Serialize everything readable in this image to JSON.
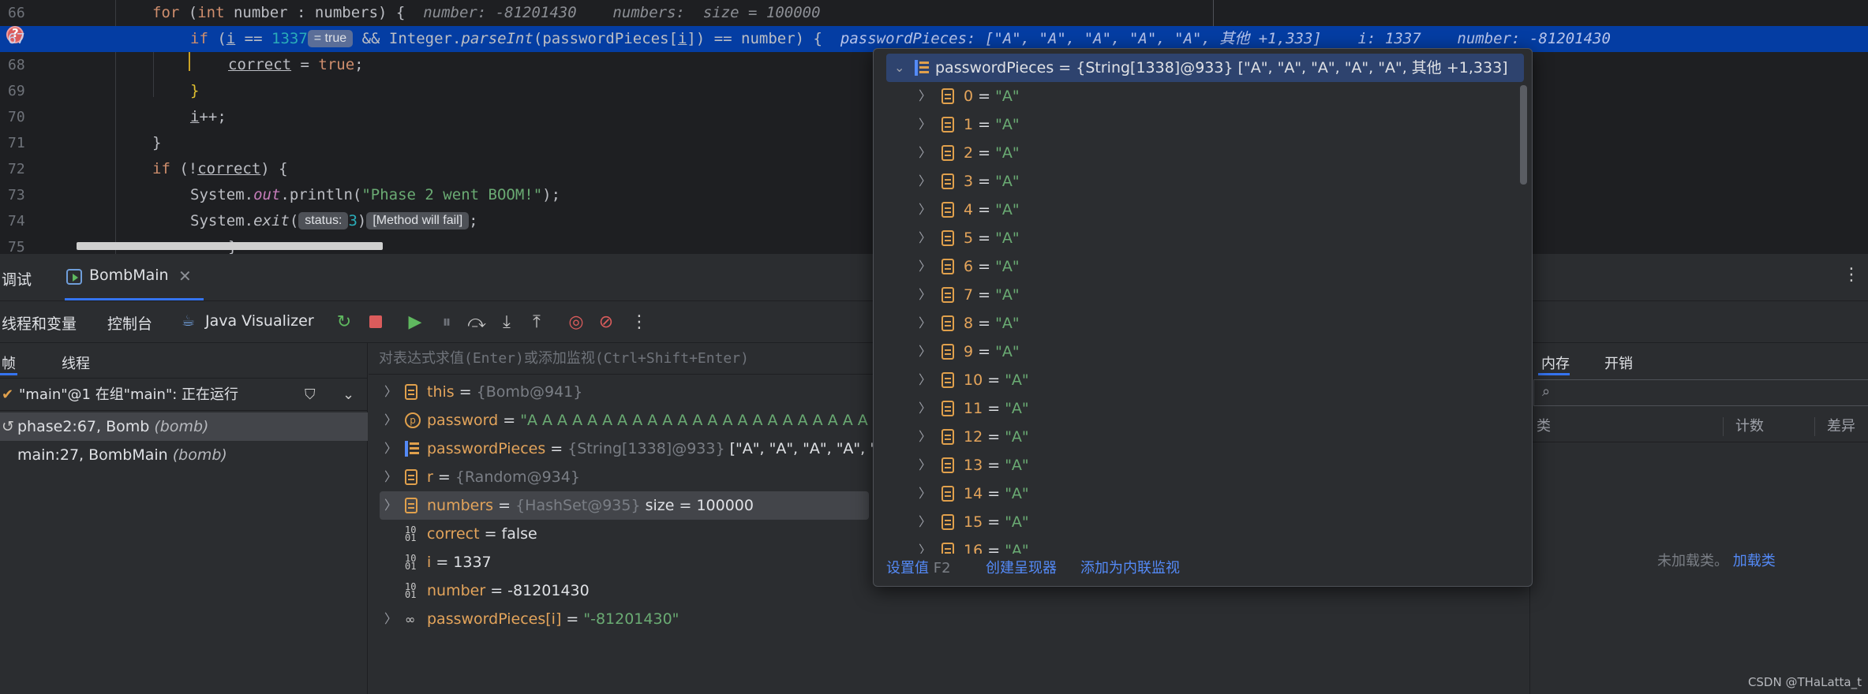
{
  "editor": {
    "lines": [
      {
        "num": "66"
      },
      {
        "num": "67"
      },
      {
        "num": "68"
      },
      {
        "num": "69"
      },
      {
        "num": "70"
      },
      {
        "num": "71"
      },
      {
        "num": "72"
      },
      {
        "num": "73"
      },
      {
        "num": "74"
      },
      {
        "num": "75"
      }
    ],
    "l66": {
      "kw_for": "for",
      "p1": " (",
      "kw_int": "int",
      "p2": " number : numbers) {",
      "inlay": "number: -81201430    numbers:  size = 100000"
    },
    "l67": {
      "kw_if": "if",
      "p1": " (",
      "var_i": "i",
      "p2": " == ",
      "num": "1337",
      "badge": "= true",
      "p3": " && Integer.",
      "method": "parseInt",
      "p4": "(passwordPieces[",
      "var_i2": "i",
      "p5": "]) == number) {",
      "inlay": "passwordPieces: [\"A\", \"A\", \"A\", \"A\", \"A\", 其他 +1,333]    i: 1337    number: -81201430"
    },
    "l68": {
      "var": "correct",
      "p1": " = ",
      "kw_true": "true",
      "p2": ";"
    },
    "l69": {
      "text": "}"
    },
    "l70": {
      "var": "i",
      "p1": "++;"
    },
    "l71": {
      "text": "}"
    },
    "l72": {
      "kw_if": "if",
      "p1": " (!",
      "var": "correct",
      "p2": ") {"
    },
    "l73": {
      "p1": "System.",
      "field": "out",
      "p2": ".println(",
      "str": "\"Phase 2 went BOOM!\"",
      "p3": ");"
    },
    "l74": {
      "p1": "System.",
      "method": "exit",
      "p2": "(",
      "badge_status": "status:",
      "num": "3",
      "p3": ")",
      "badge_fail": "[Method will fail]",
      "p4": ";"
    },
    "l75": {
      "text": "}"
    }
  },
  "debug": {
    "title": "调试",
    "session_tab": "BombMain",
    "toolbar": {
      "tab_threads_vars": "线程和变量",
      "tab_console": "控制台",
      "tab_visualizer": "Java Visualizer"
    },
    "frames": {
      "tab_frames": "帧",
      "tab_threads": "线程",
      "thread": "\"main\"@1 在组\"main\": 正在运行",
      "items": [
        {
          "method": "phase2:67, Bomb",
          "pkg": "(bomb)"
        },
        {
          "method": "main:27, BombMain",
          "pkg": "(bomb)"
        }
      ]
    },
    "variables": {
      "eval_placeholder": "对表达式求值(Enter)或添加监视(Ctrl+Shift+Enter)",
      "rows": [
        {
          "name": "this",
          "eq": " = ",
          "type": "{Bomb@941}",
          "value": ""
        },
        {
          "name": "password",
          "eq": " = ",
          "type": "",
          "value": "\"A A A A A A A A A A A A A A A A A A A A A A A A A A A A A A A A A A A A A A"
        },
        {
          "name": "passwordPieces",
          "eq": " = ",
          "type": "{String[1338]@933}",
          "value": " [\"A\", \"A\", \"A\", \"A\", \"A\","
        },
        {
          "name": "r",
          "eq": " = ",
          "type": "{Random@934}",
          "value": ""
        },
        {
          "name": "numbers",
          "eq": " = ",
          "type": "{HashSet@935}",
          "value": "  size = 100000"
        },
        {
          "name": "correct",
          "eq": " = ",
          "type": "",
          "value": "false"
        },
        {
          "name": "i",
          "eq": " = ",
          "type": "",
          "value": "1337"
        },
        {
          "name": "number",
          "eq": " = ",
          "type": "",
          "value": "-81201430"
        },
        {
          "name": "passwordPieces[i]",
          "eq": " = ",
          "type": "",
          "value": "\"-81201430\""
        }
      ]
    },
    "memory": {
      "tab_memory": "内存",
      "tab_overhead": "开销",
      "col_class": "类",
      "col_count": "计数",
      "col_diff": "差异",
      "empty_text": "未加载类。",
      "load_link": "加载类"
    },
    "watermark": "CSDN @THaLatta_t"
  },
  "popup": {
    "header_name": "passwordPieces",
    "header_eq": " = ",
    "header_type": "{String[1338]@933}",
    "header_value": " [\"A\", \"A\", \"A\", \"A\", \"A\", 其他 +1,333]",
    "items": [
      {
        "idx": "0",
        "val": "\"A\""
      },
      {
        "idx": "1",
        "val": "\"A\""
      },
      {
        "idx": "2",
        "val": "\"A\""
      },
      {
        "idx": "3",
        "val": "\"A\""
      },
      {
        "idx": "4",
        "val": "\"A\""
      },
      {
        "idx": "5",
        "val": "\"A\""
      },
      {
        "idx": "6",
        "val": "\"A\""
      },
      {
        "idx": "7",
        "val": "\"A\""
      },
      {
        "idx": "8",
        "val": "\"A\""
      },
      {
        "idx": "9",
        "val": "\"A\""
      },
      {
        "idx": "10",
        "val": "\"A\""
      },
      {
        "idx": "11",
        "val": "\"A\""
      },
      {
        "idx": "12",
        "val": "\"A\""
      },
      {
        "idx": "13",
        "val": "\"A\""
      },
      {
        "idx": "14",
        "val": "\"A\""
      },
      {
        "idx": "15",
        "val": "\"A\""
      },
      {
        "idx": "16",
        "val": "\"A\""
      }
    ],
    "footer": {
      "set_value": "设置值",
      "set_value_key": "F2",
      "create_renderer": "创建呈现器",
      "add_inline_watch": "添加为内联监视"
    }
  }
}
